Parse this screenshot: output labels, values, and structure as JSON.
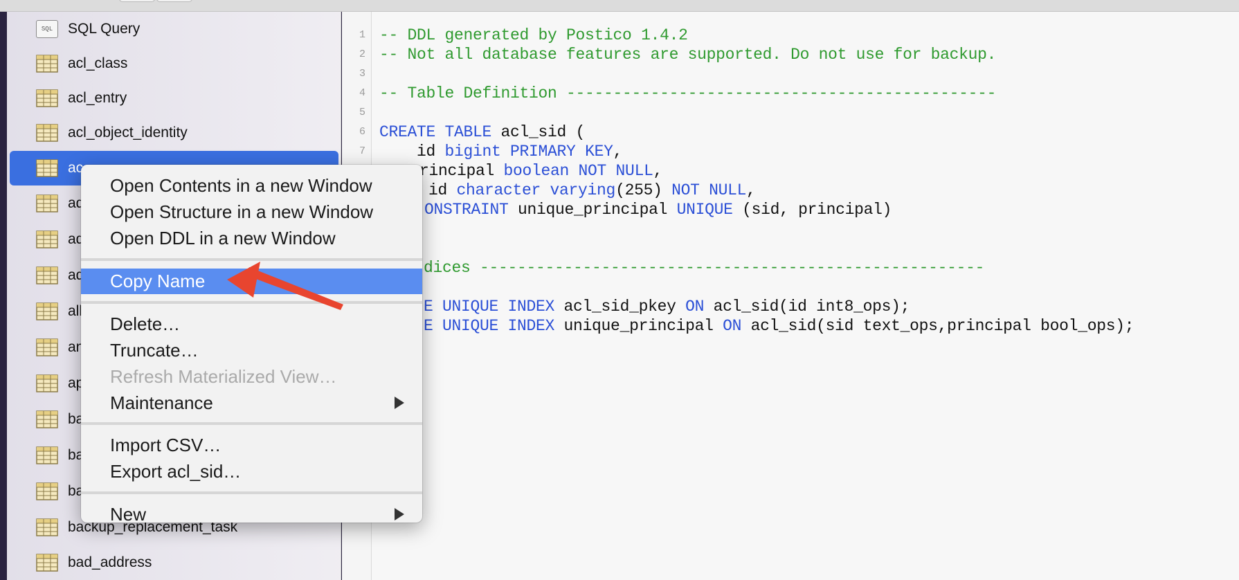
{
  "sidebar": {
    "items": [
      {
        "label": "SQL Query",
        "icon": "sql-query-icon"
      },
      {
        "label": "acl_class",
        "icon": "table-icon"
      },
      {
        "label": "acl_entry",
        "icon": "table-icon"
      },
      {
        "label": "acl_object_identity",
        "icon": "table-icon"
      },
      {
        "label": "ac",
        "icon": "table-icon",
        "selected": true
      },
      {
        "label": "ad",
        "icon": "table-icon"
      },
      {
        "label": "ad",
        "icon": "table-icon"
      },
      {
        "label": "ad",
        "icon": "table-icon"
      },
      {
        "label": "all",
        "icon": "table-icon"
      },
      {
        "label": "an",
        "icon": "table-icon"
      },
      {
        "label": "ap",
        "icon": "table-icon"
      },
      {
        "label": "ba",
        "icon": "table-icon"
      },
      {
        "label": "ba",
        "icon": "table-icon"
      },
      {
        "label": "ba",
        "icon": "table-icon"
      },
      {
        "label": "backup_replacement_task",
        "icon": "table-icon"
      },
      {
        "label": "bad_address",
        "icon": "table-icon"
      }
    ],
    "selected_color": "#3a6fe0"
  },
  "editor": {
    "line_numbers": [
      "1",
      "2",
      "3",
      "4",
      "5",
      "6",
      "7"
    ],
    "lines": [
      [
        {
          "t": "-- DDL generated by Postico 1.4.2",
          "c": "com"
        }
      ],
      [
        {
          "t": "-- Not all database features are supported. Do not use for backup.",
          "c": "com"
        }
      ],
      [
        {
          "t": "",
          "c": "id"
        }
      ],
      [
        {
          "t": "-- Table Definition ----------------------------------------------",
          "c": "com"
        }
      ],
      [
        {
          "t": "",
          "c": "id"
        }
      ],
      [
        {
          "t": "CREATE TABLE",
          "c": "kw"
        },
        {
          "t": " acl_sid (",
          "c": "id"
        }
      ],
      [
        {
          "t": "    id ",
          "c": "id"
        },
        {
          "t": "bigint PRIMARY KEY",
          "c": "kw"
        },
        {
          "t": ",",
          "c": "id"
        }
      ],
      [
        {
          "t": "rincipal ",
          "c": "id"
        },
        {
          "t": "boolean NOT NULL",
          "c": "kw"
        },
        {
          "t": ",",
          "c": "id"
        }
      ],
      [
        {
          "t": "id ",
          "c": "id"
        },
        {
          "t": "character varying",
          "c": "kw"
        },
        {
          "t": "(255) ",
          "c": "id"
        },
        {
          "t": "NOT NULL",
          "c": "kw"
        },
        {
          "t": ",",
          "c": "id"
        }
      ],
      [
        {
          "t": "ONSTRAINT",
          "c": "kw"
        },
        {
          "t": " unique_principal ",
          "c": "id"
        },
        {
          "t": "UNIQUE",
          "c": "kw"
        },
        {
          "t": " (sid, principal)",
          "c": "id"
        }
      ],
      [
        {
          "t": "dices ------------------------------------------------------",
          "c": "com"
        }
      ],
      [
        {
          "t": "E UNIQUE INDEX",
          "c": "kw"
        },
        {
          "t": " acl_sid_pkey ",
          "c": "id"
        },
        {
          "t": "ON",
          "c": "kw"
        },
        {
          "t": " acl_sid(id int8_ops);",
          "c": "id"
        }
      ],
      [
        {
          "t": "E UNIQUE INDEX",
          "c": "kw"
        },
        {
          "t": " unique_principal ",
          "c": "id"
        },
        {
          "t": "ON",
          "c": "kw"
        },
        {
          "t": " acl_sid(sid text_ops,principal bool_ops);",
          "c": "id"
        }
      ]
    ],
    "colors": {
      "comment": "#2f9a2f",
      "keyword": "#2b4fd6"
    }
  },
  "context_menu": {
    "items": [
      {
        "label": "Open Contents in a new Window"
      },
      {
        "label": "Open Structure in a new Window"
      },
      {
        "label": "Open DDL in a new Window"
      },
      {
        "label": "Copy Name",
        "highlighted": true
      },
      {
        "label": "Delete…"
      },
      {
        "label": "Truncate…"
      },
      {
        "label": "Refresh Materialized View…",
        "disabled": true
      },
      {
        "label": "Maintenance",
        "submenu": true
      },
      {
        "label": "Import CSV…"
      },
      {
        "label": "Export acl_sid…"
      },
      {
        "label": "New",
        "submenu": true
      }
    ],
    "highlight_color": "#5a8df0"
  },
  "annotation": {
    "icon": "red-arrow-pointer-icon",
    "color": "#e8452f"
  }
}
